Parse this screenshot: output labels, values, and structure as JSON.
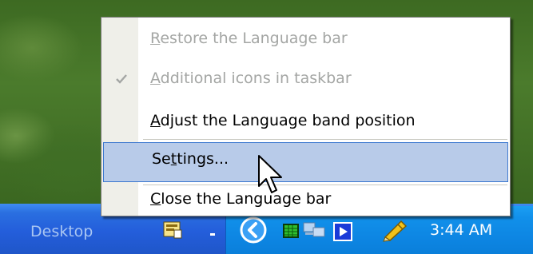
{
  "taskbar": {
    "desktop_label": "Desktop",
    "clock": "3:44 AM",
    "tray_icons": [
      "language-bar-icon",
      "chevron-down-icon",
      "back-arrow-icon",
      "green-grid-icon",
      "network-icon",
      "media-play-icon",
      "pencil-icon"
    ]
  },
  "context_menu": {
    "items": [
      {
        "prefix": "",
        "accel": "R",
        "rest": "estore the Language bar",
        "enabled": false,
        "checked": false
      },
      {
        "prefix": "",
        "accel": "A",
        "rest": "dditional icons in taskbar",
        "enabled": false,
        "checked": true
      },
      {
        "prefix": "",
        "accel": "A",
        "rest": "djust the Language band position",
        "enabled": true,
        "checked": false
      },
      {
        "prefix": "Se",
        "accel": "t",
        "rest": "tings...",
        "enabled": true,
        "checked": false,
        "highlighted": true
      },
      {
        "prefix": "",
        "accel": "C",
        "rest": "lose the Language bar",
        "enabled": true,
        "checked": false
      }
    ]
  },
  "colors": {
    "highlight_bg": "#b8cbe9",
    "highlight_border": "#3c78cf",
    "disabled_text": "#a4a6a4",
    "taskbar_blue": "#245edb",
    "tray_blue": "#0d85e2"
  }
}
